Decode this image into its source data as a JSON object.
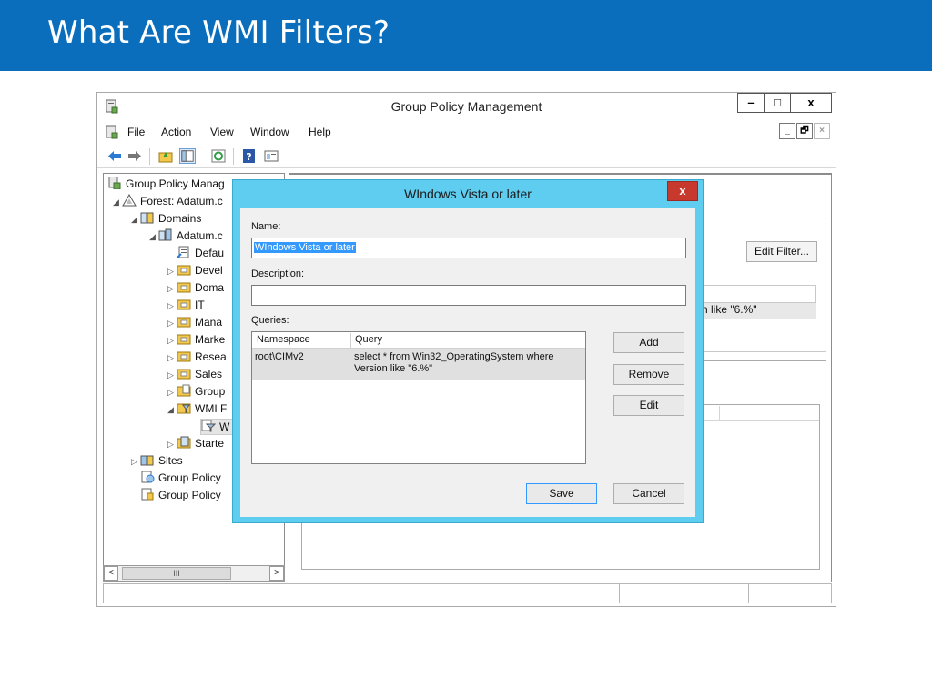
{
  "slide": {
    "title": "What Are WMI Filters?"
  },
  "window": {
    "title": "Group Policy Management",
    "controls": {
      "minimize": "–",
      "maximize": "□",
      "close": "x"
    },
    "mdi_controls": {
      "minimize": "_",
      "restore": "🗗",
      "close": "×"
    }
  },
  "menu": {
    "items": [
      "File",
      "Action",
      "View",
      "Window",
      "Help"
    ]
  },
  "tree": {
    "nodes": [
      {
        "label": "Group Policy Manag",
        "icon": "gpmc-icon",
        "expander": ""
      },
      {
        "label": "Forest: Adatum.c",
        "icon": "forest-icon",
        "expander": "◢"
      },
      {
        "label": "Domains",
        "icon": "domains-icon",
        "expander": "◢"
      },
      {
        "label": "Adatum.c",
        "icon": "domain-icon",
        "expander": "◢"
      },
      {
        "label": "Defau",
        "icon": "gpo-link-icon",
        "expander": ""
      },
      {
        "label": "Devel",
        "icon": "ou-folder-icon",
        "expander": "▷"
      },
      {
        "label": "Doma",
        "icon": "ou-folder-icon",
        "expander": "▷"
      },
      {
        "label": "IT",
        "icon": "ou-folder-icon",
        "expander": "▷"
      },
      {
        "label": "Mana",
        "icon": "ou-folder-icon",
        "expander": "▷"
      },
      {
        "label": "Marke",
        "icon": "ou-folder-icon",
        "expander": "▷"
      },
      {
        "label": "Resea",
        "icon": "ou-folder-icon",
        "expander": "▷"
      },
      {
        "label": "Sales",
        "icon": "ou-folder-icon",
        "expander": "▷"
      },
      {
        "label": "Group",
        "icon": "gpo-folder-icon",
        "expander": "▷"
      },
      {
        "label": "WMI F",
        "icon": "wmi-folder-icon",
        "expander": "◢"
      },
      {
        "label": "W",
        "icon": "wmi-filter-icon",
        "expander": ""
      },
      {
        "label": "Starte",
        "icon": "starter-gpo-icon",
        "expander": "▷"
      },
      {
        "label": "Sites",
        "icon": "sites-icon",
        "expander": "▷"
      },
      {
        "label": "Group Policy",
        "icon": "gp-modeling-icon",
        "expander": ""
      },
      {
        "label": "Group Policy",
        "icon": "gp-results-icon",
        "expander": ""
      }
    ],
    "scroll_thumb": "III"
  },
  "right_pane": {
    "edit_filter_label": "Edit Filter...",
    "partial_query_text": "n like \"6.%\""
  },
  "dialog": {
    "title": "WIndows Vista or later",
    "close_label": "x",
    "name_label": "Name:",
    "name_value": "WIndows Vista or later",
    "description_label": "Description:",
    "description_value": "",
    "queries_label": "Queries:",
    "columns": [
      "Namespace",
      "Query"
    ],
    "rows": [
      {
        "namespace": "root\\CIMv2",
        "query_line1": "select * from Win32_OperatingSystem where",
        "query_line2": "Version like \"6.%\""
      }
    ],
    "add_label": "Add",
    "remove_label": "Remove",
    "edit_label": "Edit",
    "save_label": "Save",
    "cancel_label": "Cancel"
  },
  "colors": {
    "slide_header": "#0a6ebd",
    "dialog_frame": "#5ecdf0",
    "close_button": "#c8392d",
    "selection": "#3399ff"
  }
}
